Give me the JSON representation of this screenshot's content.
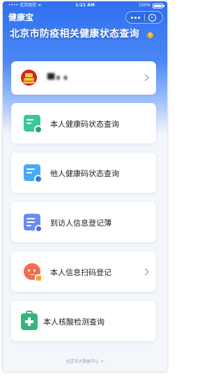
{
  "status_bar": {
    "carrier": "•••• 北京经信 ᯤ",
    "time": "1:21 AM",
    "battery_text": "100%"
  },
  "app": {
    "title": "健康宝",
    "heading": "北京市防疫相关健康状态查询",
    "help_badge": "!"
  },
  "user_card": {
    "name": "█▌▖▗"
  },
  "menu": {
    "health_code_self": "本人健康码状态查询",
    "health_code_other": "他人健康码状态查询",
    "visitor_register": "到访人信息登记薄",
    "scan_register": "本人信息扫码登记",
    "nucleic_test": "本人核酸检测查询"
  },
  "footer": {
    "text": "北京市大数据中心 ✍"
  },
  "colors": {
    "header_blue": "#2f6ff0",
    "green": "#3cc79a",
    "blue": "#4aa9f5",
    "indigo": "#6b8cf2",
    "orange": "#f26d4f",
    "emblem_red": "#d7221c"
  }
}
